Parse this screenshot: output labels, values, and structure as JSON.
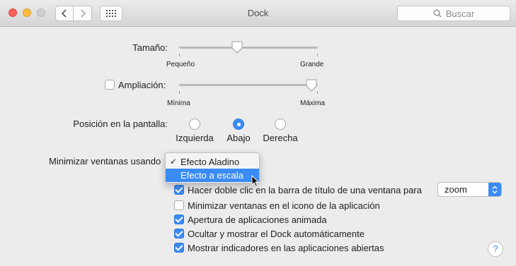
{
  "window": {
    "title": "Dock"
  },
  "toolbar": {
    "search_placeholder": "Buscar"
  },
  "size": {
    "label": "Tamaño:",
    "min_label": "Pequeño",
    "max_label": "Grande",
    "value_fraction": 0.43
  },
  "magnification": {
    "label": "Ampliación:",
    "checked": false,
    "min_label": "Mínima",
    "max_label": "Máxima",
    "value_fraction": 0.96
  },
  "position": {
    "label": "Posición en la pantalla:",
    "options": [
      "Izquierda",
      "Abajo",
      "Derecha"
    ],
    "selected": "Abajo"
  },
  "minimize": {
    "label": "Minimizar ventanas usando",
    "menu_items": [
      "Efecto Aladino",
      "Efecto a escala"
    ],
    "checked_item": "Efecto Aladino",
    "highlighted_item": "Efecto a escala"
  },
  "checkboxes": [
    {
      "label": "Hacer doble clic en la barra de título de una ventana para",
      "checked": true
    },
    {
      "label": "Minimizar ventanas en el icono de la aplicación",
      "checked": false
    },
    {
      "label": "Apertura de aplicaciones animada",
      "checked": true
    },
    {
      "label": "Ocultar y mostrar el Dock automáticamente",
      "checked": true
    },
    {
      "label": "Mostrar indicadores en las aplicaciones abiertas",
      "checked": true
    }
  ],
  "doubleclick_action": {
    "selected": "zoom"
  },
  "help": {
    "symbol": "?"
  },
  "colors": {
    "accent": "#3a8bf4"
  }
}
